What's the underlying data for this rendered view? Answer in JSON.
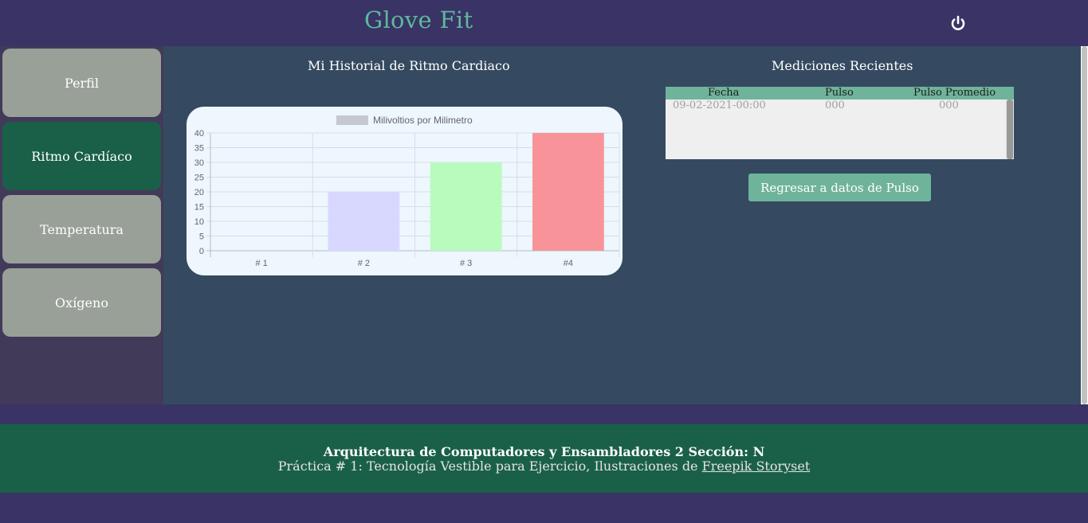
{
  "header": {
    "title": "Glove Fit",
    "power_icon": "power-icon"
  },
  "sidebar": {
    "items": [
      {
        "label": "Perfil",
        "active": false
      },
      {
        "label": "Ritmo Cardíaco",
        "active": true
      },
      {
        "label": "Temperatura",
        "active": false
      },
      {
        "label": "Oxígeno",
        "active": false
      }
    ]
  },
  "chart_section": {
    "title": "Mi Historial de Ritmo Cardiaco"
  },
  "chart_data": {
    "type": "bar",
    "categories": [
      "# 1",
      "# 2",
      "# 3",
      "#4"
    ],
    "series": [
      {
        "name": "Milivoltios por Milimetro",
        "values": [
          0,
          20,
          30,
          40
        ]
      }
    ],
    "bar_colors": [
      "#c9c9c9",
      "#d8d8ff",
      "#b8fbbd",
      "#f89499"
    ],
    "legend_swatch_color": "#c6c8cf",
    "ylim": [
      0,
      40
    ],
    "yticks": [
      0,
      5,
      10,
      15,
      20,
      25,
      30,
      35,
      40
    ],
    "grid": true,
    "legend": "top"
  },
  "recent": {
    "title": "Mediciones Recientes",
    "columns": [
      "Fecha",
      "Pulso",
      "Pulso Promedio"
    ],
    "rows": [
      [
        "09-02-2021-00:00",
        "000",
        "000"
      ]
    ],
    "back_button": "Regresar a datos de Pulso"
  },
  "footer": {
    "title": "Arquitectura de Computadores y Ensambladores 2 Sección: N",
    "subtitle_prefix": "Práctica # 1: Tecnología Vestible para Ejercicio, Ilustraciones de ",
    "link_text": "Freepik Storyset"
  },
  "colors": {
    "background": "#393366",
    "main_panel": "#354a60",
    "accent_green": "#6fb49a",
    "dark_green": "#1a6048",
    "nav_inactive": "#99a098",
    "brand": "#5fb89a"
  }
}
